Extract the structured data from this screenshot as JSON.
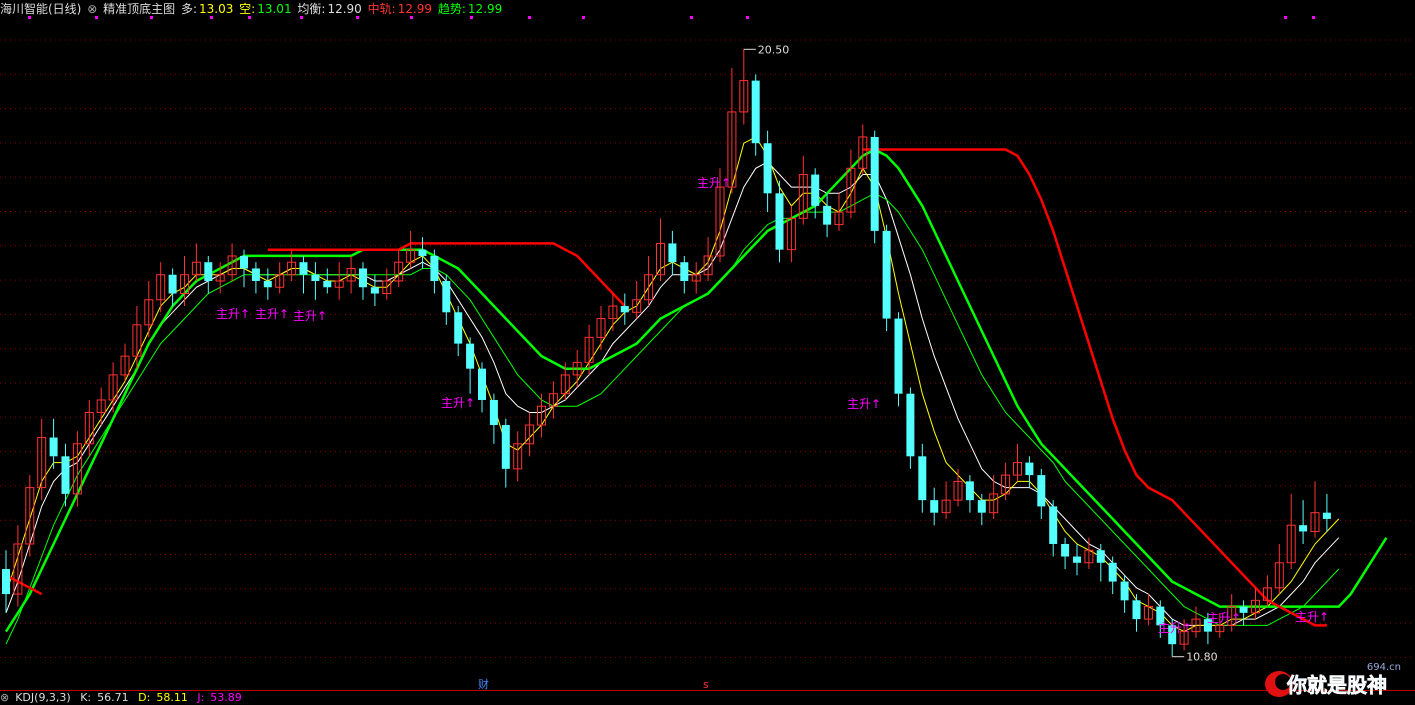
{
  "header": {
    "stock_name": "海川智能(日线)",
    "indicator_name": "精准顶底主图",
    "duo_label": "多:",
    "duo_value": "13.03",
    "kong_label": "空:",
    "kong_value": "13.01",
    "junheng_label": "均衡:",
    "junheng_value": "12.90",
    "zhonggui_label": "中轨:",
    "zhonggui_value": "12.99",
    "qushi_label": "趋势:",
    "qushi_value": "12.99"
  },
  "kdj": {
    "name": "KDJ(9,3,3)",
    "k_label": "K:",
    "k_value": "56.71",
    "d_label": "D:",
    "d_value": "58.11",
    "j_label": "J:",
    "j_value": "53.89"
  },
  "annotations": {
    "high_price": "20.50",
    "low_price": "10.80",
    "signal_text": "主升↑",
    "marker_cai": "财",
    "marker_s": "s"
  },
  "logo": {
    "text": "你就是股神",
    "site": "694.cn"
  },
  "colors": {
    "background": "#000000",
    "candle_up": "#ff3232",
    "candle_down": "#54ffff",
    "duo_line": "#ffffff",
    "kong_line": "#ffff00",
    "junheng_line": "#00ff00",
    "zhonggui_line": "#00ff00",
    "qushi_line": "#ff0000",
    "signal": "#ff00ff",
    "grid": "#8b0000"
  },
  "chart_data": {
    "type": "candlestick",
    "y_range": [
      10.3,
      21.0
    ],
    "high": 20.5,
    "low": 10.8,
    "candles": [
      [
        12.2,
        11.8,
        12.5,
        11.5
      ],
      [
        11.8,
        12.6,
        12.9,
        11.6
      ],
      [
        12.6,
        13.5,
        13.7,
        12.4
      ],
      [
        13.5,
        14.3,
        14.6,
        13.3
      ],
      [
        14.3,
        14.0,
        14.6,
        13.8
      ],
      [
        14.0,
        13.4,
        14.2,
        13.2
      ],
      [
        13.4,
        14.2,
        14.4,
        13.2
      ],
      [
        14.2,
        14.7,
        14.9,
        14.0
      ],
      [
        14.7,
        14.9,
        15.1,
        14.5
      ],
      [
        14.9,
        15.3,
        15.5,
        14.7
      ],
      [
        15.3,
        15.6,
        15.8,
        15.2
      ],
      [
        15.6,
        16.1,
        16.4,
        15.4
      ],
      [
        16.1,
        16.5,
        16.8,
        15.9
      ],
      [
        16.5,
        16.9,
        17.1,
        16.3
      ],
      [
        16.9,
        16.6,
        17.0,
        16.4
      ],
      [
        16.6,
        16.9,
        17.2,
        16.4
      ],
      [
        16.9,
        17.1,
        17.4,
        16.8
      ],
      [
        17.1,
        16.8,
        17.2,
        16.6
      ],
      [
        16.8,
        16.9,
        17.1,
        16.6
      ],
      [
        16.9,
        17.2,
        17.4,
        16.8
      ],
      [
        17.2,
        17.0,
        17.3,
        16.7
      ],
      [
        17.0,
        16.8,
        17.1,
        16.6
      ],
      [
        16.8,
        16.7,
        17.0,
        16.5
      ],
      [
        16.7,
        16.9,
        17.1,
        16.6
      ],
      [
        16.9,
        17.1,
        17.3,
        16.8
      ],
      [
        17.1,
        16.9,
        17.2,
        16.6
      ],
      [
        16.9,
        16.8,
        17.1,
        16.5
      ],
      [
        16.8,
        16.7,
        17.0,
        16.6
      ],
      [
        16.7,
        16.8,
        17.1,
        16.5
      ],
      [
        16.8,
        17.0,
        17.2,
        16.6
      ],
      [
        17.0,
        16.7,
        17.1,
        16.5
      ],
      [
        16.7,
        16.6,
        16.9,
        16.4
      ],
      [
        16.6,
        16.8,
        17.0,
        16.5
      ],
      [
        16.8,
        17.1,
        17.3,
        16.7
      ],
      [
        17.1,
        17.3,
        17.6,
        17.0
      ],
      [
        17.3,
        17.2,
        17.5,
        17.0
      ],
      [
        17.2,
        16.8,
        17.3,
        16.6
      ],
      [
        16.8,
        16.3,
        16.9,
        16.1
      ],
      [
        16.3,
        15.8,
        16.4,
        15.6
      ],
      [
        15.8,
        15.4,
        15.9,
        15.0
      ],
      [
        15.4,
        14.9,
        15.5,
        14.7
      ],
      [
        14.9,
        14.5,
        15.0,
        14.2
      ],
      [
        14.5,
        13.8,
        14.6,
        13.5
      ],
      [
        13.8,
        14.2,
        14.4,
        13.6
      ],
      [
        14.2,
        14.5,
        14.7,
        14.0
      ],
      [
        14.5,
        14.8,
        15.0,
        14.3
      ],
      [
        14.8,
        15.0,
        15.2,
        14.6
      ],
      [
        15.0,
        15.3,
        15.5,
        14.9
      ],
      [
        15.3,
        15.5,
        15.7,
        15.1
      ],
      [
        15.5,
        15.9,
        16.1,
        15.3
      ],
      [
        15.9,
        16.2,
        16.4,
        15.7
      ],
      [
        16.2,
        16.4,
        16.6,
        16.0
      ],
      [
        16.4,
        16.3,
        16.6,
        16.1
      ],
      [
        16.3,
        16.5,
        16.8,
        16.2
      ],
      [
        16.5,
        16.9,
        17.2,
        16.4
      ],
      [
        16.9,
        17.4,
        17.8,
        16.8
      ],
      [
        17.4,
        17.1,
        17.6,
        16.9
      ],
      [
        17.1,
        16.8,
        17.2,
        16.6
      ],
      [
        16.8,
        16.9,
        17.1,
        16.6
      ],
      [
        16.9,
        17.2,
        17.5,
        16.8
      ],
      [
        17.2,
        18.3,
        18.6,
        17.1
      ],
      [
        18.3,
        19.5,
        20.2,
        18.2
      ],
      [
        19.5,
        20.0,
        20.5,
        19.3
      ],
      [
        20.0,
        19.0,
        20.1,
        18.8
      ],
      [
        19.0,
        18.2,
        19.2,
        17.9
      ],
      [
        18.2,
        17.3,
        18.4,
        17.1
      ],
      [
        17.3,
        17.8,
        18.0,
        17.1
      ],
      [
        17.8,
        18.5,
        18.8,
        17.7
      ],
      [
        18.5,
        18.0,
        18.6,
        17.8
      ],
      [
        18.0,
        17.7,
        18.2,
        17.5
      ],
      [
        17.7,
        17.9,
        18.2,
        17.6
      ],
      [
        17.9,
        18.6,
        18.9,
        17.8
      ],
      [
        18.6,
        19.1,
        19.3,
        18.5
      ],
      [
        19.1,
        17.6,
        19.2,
        17.4
      ],
      [
        17.6,
        16.2,
        17.7,
        16.0
      ],
      [
        16.2,
        15.0,
        16.3,
        14.8
      ],
      [
        15.0,
        14.0,
        15.1,
        13.8
      ],
      [
        14.0,
        13.3,
        14.2,
        13.1
      ],
      [
        13.3,
        13.1,
        13.5,
        12.9
      ],
      [
        13.1,
        13.3,
        13.6,
        13.0
      ],
      [
        13.3,
        13.6,
        13.8,
        13.2
      ],
      [
        13.6,
        13.3,
        13.7,
        13.1
      ],
      [
        13.3,
        13.1,
        13.4,
        12.9
      ],
      [
        13.1,
        13.4,
        13.7,
        13.0
      ],
      [
        13.4,
        13.7,
        13.9,
        13.3
      ],
      [
        13.7,
        13.9,
        14.2,
        13.6
      ],
      [
        13.9,
        13.7,
        14.0,
        13.5
      ],
      [
        13.7,
        13.2,
        13.8,
        13.0
      ],
      [
        13.2,
        12.6,
        13.3,
        12.4
      ],
      [
        12.6,
        12.4,
        12.7,
        12.2
      ],
      [
        12.4,
        12.3,
        12.6,
        12.1
      ],
      [
        12.3,
        12.5,
        12.7,
        12.2
      ],
      [
        12.5,
        12.3,
        12.6,
        12.0
      ],
      [
        12.3,
        12.0,
        12.4,
        11.8
      ],
      [
        12.0,
        11.7,
        12.1,
        11.5
      ],
      [
        11.7,
        11.4,
        11.8,
        11.2
      ],
      [
        11.4,
        11.6,
        11.8,
        11.3
      ],
      [
        11.6,
        11.3,
        11.7,
        11.1
      ],
      [
        11.3,
        11.0,
        11.4,
        10.8
      ],
      [
        11.0,
        11.2,
        11.4,
        10.9
      ],
      [
        11.2,
        11.4,
        11.6,
        11.1
      ],
      [
        11.4,
        11.2,
        11.5,
        11.0
      ],
      [
        11.2,
        11.3,
        11.5,
        11.1
      ],
      [
        11.3,
        11.6,
        11.8,
        11.2
      ],
      [
        11.6,
        11.5,
        11.7,
        11.3
      ],
      [
        11.5,
        11.7,
        11.9,
        11.4
      ],
      [
        11.7,
        11.9,
        12.1,
        11.6
      ],
      [
        11.9,
        12.3,
        12.6,
        11.8
      ],
      [
        12.3,
        12.9,
        13.4,
        12.2
      ],
      [
        12.9,
        12.8,
        13.3,
        12.6
      ],
      [
        12.8,
        13.1,
        13.6,
        12.7
      ],
      [
        13.1,
        13.0,
        13.4,
        12.8
      ]
    ],
    "series": [
      {
        "name": "多",
        "values": [
          11.5,
          12.0,
          12.6,
          13.2,
          13.6,
          13.8,
          13.9,
          14.2,
          14.5,
          14.8,
          15.1,
          15.4,
          15.8,
          16.1,
          16.3,
          16.5,
          16.7,
          16.8,
          16.9,
          17.0,
          17.0,
          16.9,
          16.9,
          16.9,
          17.0,
          17.0,
          16.9,
          16.9,
          16.9,
          16.9,
          16.9,
          16.8,
          16.8,
          16.9,
          17.0,
          17.1,
          17.0,
          16.8,
          16.5,
          16.2,
          15.9,
          15.5,
          15.0,
          14.8,
          14.7,
          14.7,
          14.8,
          14.9,
          15.1,
          15.3,
          15.5,
          15.8,
          16.0,
          16.2,
          16.4,
          16.7,
          16.9,
          16.9,
          16.9,
          17.0,
          17.3,
          17.8,
          18.3,
          18.6,
          18.7,
          18.5,
          18.3,
          18.3,
          18.3,
          18.2,
          18.2,
          18.3,
          18.5,
          18.5,
          18.1,
          17.5,
          16.9,
          16.2,
          15.6,
          15.1,
          14.6,
          14.2,
          13.8,
          13.6,
          13.5,
          13.5,
          13.5,
          13.4,
          13.2,
          13.0,
          12.8,
          12.6,
          12.5,
          12.3,
          12.1,
          11.9,
          11.8,
          11.6,
          11.4,
          11.3,
          11.3,
          11.3,
          11.3,
          11.3,
          11.4,
          11.4,
          11.5,
          11.6,
          11.8,
          12.0,
          12.3,
          12.5,
          12.7
        ]
      },
      {
        "name": "空",
        "values": [
          11.8,
          12.4,
          13.0,
          13.6,
          13.9,
          13.9,
          14.0,
          14.3,
          14.6,
          14.9,
          15.2,
          15.6,
          16.0,
          16.4,
          16.6,
          16.7,
          16.9,
          16.9,
          16.9,
          17.0,
          17.0,
          16.9,
          16.8,
          16.9,
          17.0,
          17.0,
          16.9,
          16.8,
          16.8,
          16.9,
          16.8,
          16.7,
          16.7,
          16.9,
          17.1,
          17.2,
          17.0,
          16.6,
          16.2,
          15.8,
          15.3,
          14.8,
          14.2,
          14.1,
          14.3,
          14.5,
          14.8,
          15.0,
          15.2,
          15.5,
          15.8,
          16.1,
          16.3,
          16.4,
          16.7,
          17.0,
          17.1,
          17.0,
          16.9,
          17.1,
          17.6,
          18.3,
          19.0,
          19.1,
          18.8,
          18.3,
          18.0,
          18.2,
          18.2,
          18.0,
          17.9,
          18.2,
          18.6,
          18.3,
          17.5,
          16.6,
          15.8,
          15.0,
          14.4,
          13.9,
          13.7,
          13.5,
          13.3,
          13.3,
          13.4,
          13.6,
          13.6,
          13.4,
          13.1,
          12.8,
          12.6,
          12.5,
          12.4,
          12.2,
          12.0,
          11.7,
          11.6,
          11.5,
          11.3,
          11.2,
          11.3,
          11.3,
          11.3,
          11.4,
          11.4,
          11.5,
          11.6,
          11.8,
          12.0,
          12.3,
          12.6,
          12.8,
          13.0
        ]
      },
      {
        "name": "均衡",
        "values": [
          11.0,
          11.4,
          11.9,
          12.4,
          12.9,
          13.3,
          13.7,
          14.0,
          14.3,
          14.6,
          14.9,
          15.2,
          15.5,
          15.8,
          16.0,
          16.2,
          16.4,
          16.6,
          16.7,
          16.8,
          16.9,
          16.9,
          16.9,
          16.9,
          16.9,
          16.9,
          16.9,
          16.9,
          16.9,
          16.9,
          16.9,
          16.9,
          16.9,
          16.9,
          16.9,
          17.0,
          17.0,
          16.9,
          16.7,
          16.5,
          16.2,
          15.9,
          15.6,
          15.3,
          15.1,
          14.9,
          14.8,
          14.8,
          14.8,
          14.9,
          15.0,
          15.2,
          15.4,
          15.6,
          15.8,
          16.0,
          16.2,
          16.4,
          16.5,
          16.6,
          16.8,
          17.0,
          17.3,
          17.5,
          17.7,
          17.8,
          17.8,
          17.9,
          17.9,
          17.9,
          17.9,
          18.0,
          18.1,
          18.2,
          18.1,
          17.9,
          17.6,
          17.3,
          16.9,
          16.5,
          16.1,
          15.7,
          15.3,
          15.0,
          14.7,
          14.5,
          14.3,
          14.1,
          13.9,
          13.6,
          13.4,
          13.2,
          13.0,
          12.8,
          12.6,
          12.4,
          12.2,
          12.0,
          11.8,
          11.6,
          11.5,
          11.4,
          11.3,
          11.3,
          11.3,
          11.3,
          11.3,
          11.4,
          11.5,
          11.6,
          11.8,
          12.0,
          12.2
        ]
      },
      {
        "name": "中轨",
        "values": [
          11.2,
          11.5,
          11.8,
          12.2,
          12.6,
          13.0,
          13.4,
          13.8,
          14.2,
          14.6,
          15.0,
          15.4,
          15.8,
          16.1,
          16.4,
          16.6,
          16.8,
          16.9,
          17.0,
          17.1,
          17.2,
          17.2,
          17.2,
          17.2,
          17.2,
          17.2,
          17.2,
          17.2,
          17.2,
          17.2,
          17.3,
          17.3,
          17.3,
          17.3,
          17.3,
          17.3,
          17.2,
          17.1,
          17.0,
          16.8,
          16.6,
          16.4,
          16.2,
          16.0,
          15.8,
          15.6,
          15.5,
          15.4,
          15.4,
          15.4,
          15.5,
          15.6,
          15.7,
          15.8,
          16.0,
          16.2,
          16.3,
          16.4,
          16.5,
          16.6,
          16.8,
          17.0,
          17.2,
          17.4,
          17.6,
          17.7,
          17.8,
          17.9,
          18.0,
          18.2,
          18.4,
          18.6,
          18.8,
          18.9,
          18.8,
          18.6,
          18.3,
          18.0,
          17.6,
          17.2,
          16.8,
          16.4,
          16.0,
          15.6,
          15.2,
          14.8,
          14.5,
          14.2,
          14.0,
          13.8,
          13.6,
          13.4,
          13.2,
          13.0,
          12.8,
          12.6,
          12.4,
          12.2,
          12.0,
          11.9,
          11.8,
          11.7,
          11.6,
          11.6,
          11.6,
          11.6,
          11.6,
          11.6,
          11.6,
          11.6,
          11.6,
          11.6,
          11.6,
          11.8,
          12.1,
          12.4,
          12.7
        ]
      },
      {
        "name": "趋势",
        "values": [
          12.1,
          12.0,
          11.9,
          11.8,
          null,
          null,
          null,
          null,
          null,
          null,
          null,
          null,
          null,
          null,
          null,
          null,
          null,
          null,
          null,
          null,
          null,
          null,
          17.3,
          17.3,
          17.3,
          17.3,
          17.3,
          17.3,
          17.3,
          17.3,
          17.3,
          17.3,
          17.3,
          17.3,
          17.4,
          17.4,
          17.4,
          17.4,
          17.4,
          17.4,
          17.4,
          17.4,
          17.4,
          17.4,
          17.4,
          17.4,
          17.4,
          17.3,
          17.2,
          17.0,
          16.8,
          16.6,
          16.4,
          null,
          null,
          null,
          null,
          null,
          null,
          null,
          null,
          null,
          null,
          null,
          null,
          null,
          null,
          null,
          null,
          null,
          null,
          null,
          18.9,
          18.9,
          18.9,
          18.9,
          18.9,
          18.9,
          18.9,
          18.9,
          18.9,
          18.9,
          18.9,
          18.9,
          18.9,
          18.8,
          18.5,
          18.1,
          17.6,
          17.0,
          16.4,
          15.8,
          15.2,
          14.6,
          14.1,
          13.7,
          13.5,
          13.4,
          13.3,
          13.1,
          12.9,
          12.7,
          12.5,
          12.3,
          12.1,
          11.9,
          11.7,
          11.6,
          11.5,
          11.4,
          11.3,
          11.3,
          null,
          null,
          null,
          null,
          null,
          null,
          null,
          null,
          null
        ]
      }
    ]
  }
}
